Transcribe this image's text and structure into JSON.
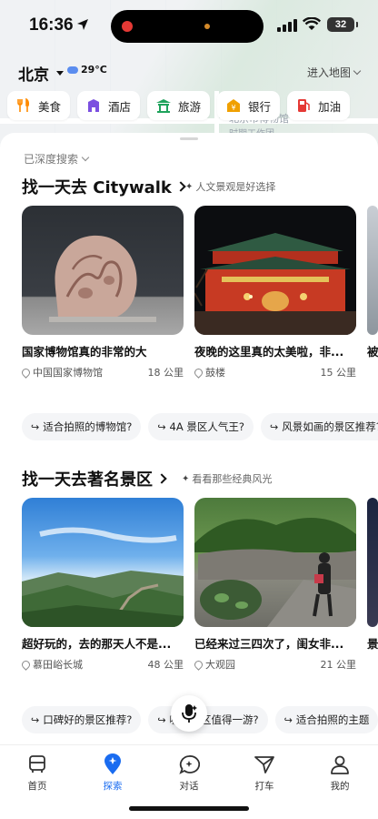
{
  "status_bar": {
    "time": "16:36",
    "battery": "32"
  },
  "location": {
    "city": "北京",
    "temperature": "29°C",
    "enter_map": "进入地图"
  },
  "map_labels": [
    "时期工作团",
    "北京市博物馆"
  ],
  "categories": [
    {
      "label": "美食",
      "icon": "fork-knife-icon",
      "color": "#ff8a00"
    },
    {
      "label": "酒店",
      "icon": "hotel-icon",
      "color": "#7b4fe0"
    },
    {
      "label": "旅游",
      "icon": "pavilion-icon",
      "color": "#1fa35c"
    },
    {
      "label": "银行",
      "icon": "bank-icon",
      "color": "#f0a000"
    },
    {
      "label": "加油",
      "icon": "fuel-icon",
      "color": "#e53935"
    }
  ],
  "sheet": {
    "deep_search": "已深度搜索"
  },
  "section1": {
    "title": "找一天去 Citywalk",
    "subtitle": "人文景观是好选择",
    "cards": [
      {
        "title": "国家博物馆真的非常的大",
        "place": "中国国家博物馆",
        "distance": "18 公里"
      },
      {
        "title": "夜晚的这里真的太美啦，非...",
        "place": "鼓楼",
        "distance": "15 公里"
      },
      {
        "title": "被",
        "place": "",
        "distance": ""
      }
    ],
    "questions": [
      "适合拍照的博物馆?",
      "4A 景区人气王?",
      "风景如画的景区推荐?"
    ]
  },
  "section2": {
    "title": "找一天去著名景区",
    "subtitle": "看看那些经典风光",
    "cards": [
      {
        "title": "超好玩的，去的那天人不是...",
        "place": "慕田峪长城",
        "distance": "48 公里"
      },
      {
        "title": "已经来过三四次了，闺女非...",
        "place": "大观园",
        "distance": "21 公里"
      },
      {
        "title": "景",
        "place": "",
        "distance": ""
      }
    ],
    "questions": [
      "口碑好的景区推荐?",
      "哪些景区值得一游?",
      "适合拍照的主题"
    ]
  },
  "tabs": [
    {
      "label": "首页",
      "icon": "bus-icon",
      "active": false
    },
    {
      "label": "探索",
      "icon": "location-pin-icon",
      "active": true
    },
    {
      "label": "对话",
      "icon": "chat-bubble-icon",
      "active": false
    },
    {
      "label": "打车",
      "icon": "paper-plane-icon",
      "active": false
    },
    {
      "label": "我的",
      "icon": "person-icon",
      "active": false
    }
  ],
  "colors": {
    "accent": "#1a6cf0",
    "text": "#111111"
  }
}
